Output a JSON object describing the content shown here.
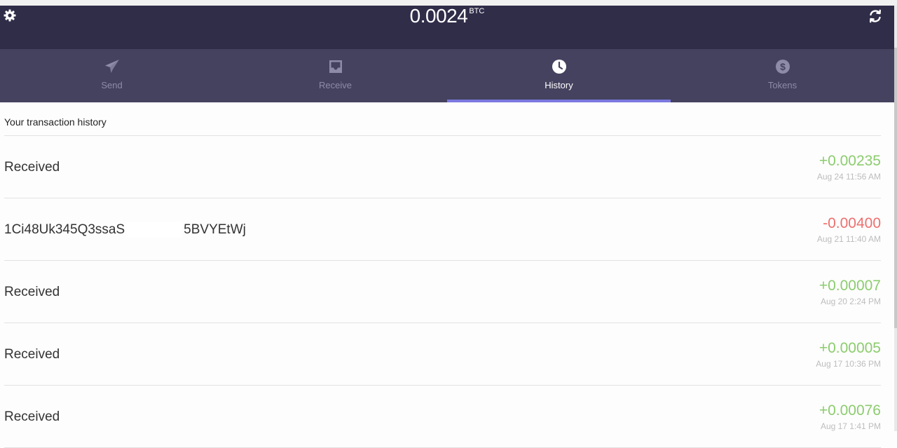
{
  "header": {
    "balance": "0.0024",
    "unit": "BTC"
  },
  "tabs": [
    {
      "label": "Send",
      "icon": "send-icon",
      "active": false
    },
    {
      "label": "Receive",
      "icon": "inbox-icon",
      "active": false
    },
    {
      "label": "History",
      "icon": "clock-icon",
      "active": true
    },
    {
      "label": "Tokens",
      "icon": "dollar-coin-icon",
      "active": false
    }
  ],
  "history": {
    "title": "Your transaction history",
    "transactions": [
      {
        "label": "Received",
        "amount": "+0.00235",
        "date": "Aug 24 11:56 AM",
        "direction": "in"
      },
      {
        "label_start": "1Ci48Uk345Q3ssaS",
        "label_end": "5BVYEtWj",
        "amount": "-0.00400",
        "date": "Aug 21 11:40 AM",
        "direction": "out"
      },
      {
        "label": "Received",
        "amount": "+0.00007",
        "date": "Aug 20 2:24 PM",
        "direction": "in"
      },
      {
        "label": "Received",
        "amount": "+0.00005",
        "date": "Aug 17 10:36 PM",
        "direction": "in"
      },
      {
        "label": "Received",
        "amount": "+0.00076",
        "date": "Aug 17 1:41 PM",
        "direction": "in"
      }
    ]
  },
  "colors": {
    "header_bg": "#302d49",
    "tabs_bg": "#45425f",
    "tab_active_indicator": "#7b78e0",
    "positive": "#8ccc6e",
    "negative": "#ee6f6f"
  }
}
